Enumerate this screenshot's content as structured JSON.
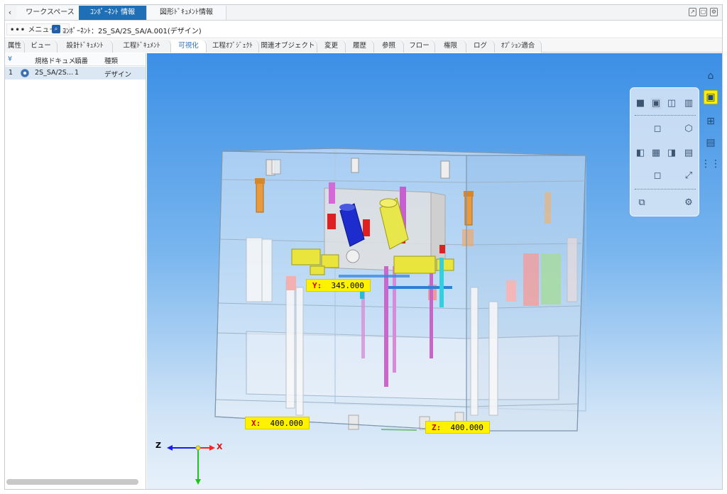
{
  "top_tabs": [
    {
      "label": "ワークスペース",
      "active": false
    },
    {
      "label": "ｺﾝﾎﾟｰﾈﾝﾄ 情報",
      "active": true
    },
    {
      "label": "図形ﾄﾞｷｭﾒﾝﾄ情報",
      "active": false
    }
  ],
  "toolbar": {
    "menu_label": "メニュー",
    "breadcrumb": "ｺﾝﾎﾟｰﾈﾝﾄ：2S_SA/2S_SA/A.001(デザイン)"
  },
  "detail_tabs": [
    {
      "label": "属性",
      "active": false
    },
    {
      "label": "ビュー",
      "active": false
    },
    {
      "label": "設計ﾄﾞｷｭﾒﾝﾄ",
      "active": false
    },
    {
      "label": "工程ﾄﾞｷｭﾒﾝﾄ",
      "active": false
    },
    {
      "label": "可視化",
      "active": true
    },
    {
      "label": "工程ｵﾌﾞｼﾞｪｸﾄ",
      "active": false
    },
    {
      "label": "関連オブジェクト",
      "active": false
    },
    {
      "label": "変更",
      "active": false
    },
    {
      "label": "履歴",
      "active": false
    },
    {
      "label": "参照",
      "active": false
    },
    {
      "label": "フロー",
      "active": false
    },
    {
      "label": "権限",
      "active": false
    },
    {
      "label": "ログ",
      "active": false
    },
    {
      "label": "ｵﾌﾟｼｮﾝ適合",
      "active": false
    }
  ],
  "table": {
    "columns": [
      "規格ドキュメ…",
      "順番",
      "種類"
    ],
    "rows": [
      {
        "index": "1",
        "name": "2S_SA/2S…",
        "order": "1",
        "type": "デザイン"
      }
    ]
  },
  "measurements": {
    "y": {
      "axis": "Y:",
      "value": "345.000"
    },
    "x": {
      "axis": "X:",
      "value": "400.000"
    },
    "z": {
      "axis": "Z:",
      "value": "400.000"
    }
  },
  "triad": {
    "z": "Z",
    "x": "X"
  },
  "icons": {
    "home": "home-icon",
    "model_view": "model-view-icon",
    "tree": "tree-icon",
    "properties": "properties-icon",
    "grid": "grid-icon"
  },
  "colors": {
    "accent": "#1f6fb6",
    "highlight": "#fff200",
    "viewport_top": "#3b8fe6",
    "viewport_bottom": "#e8f1fa"
  }
}
